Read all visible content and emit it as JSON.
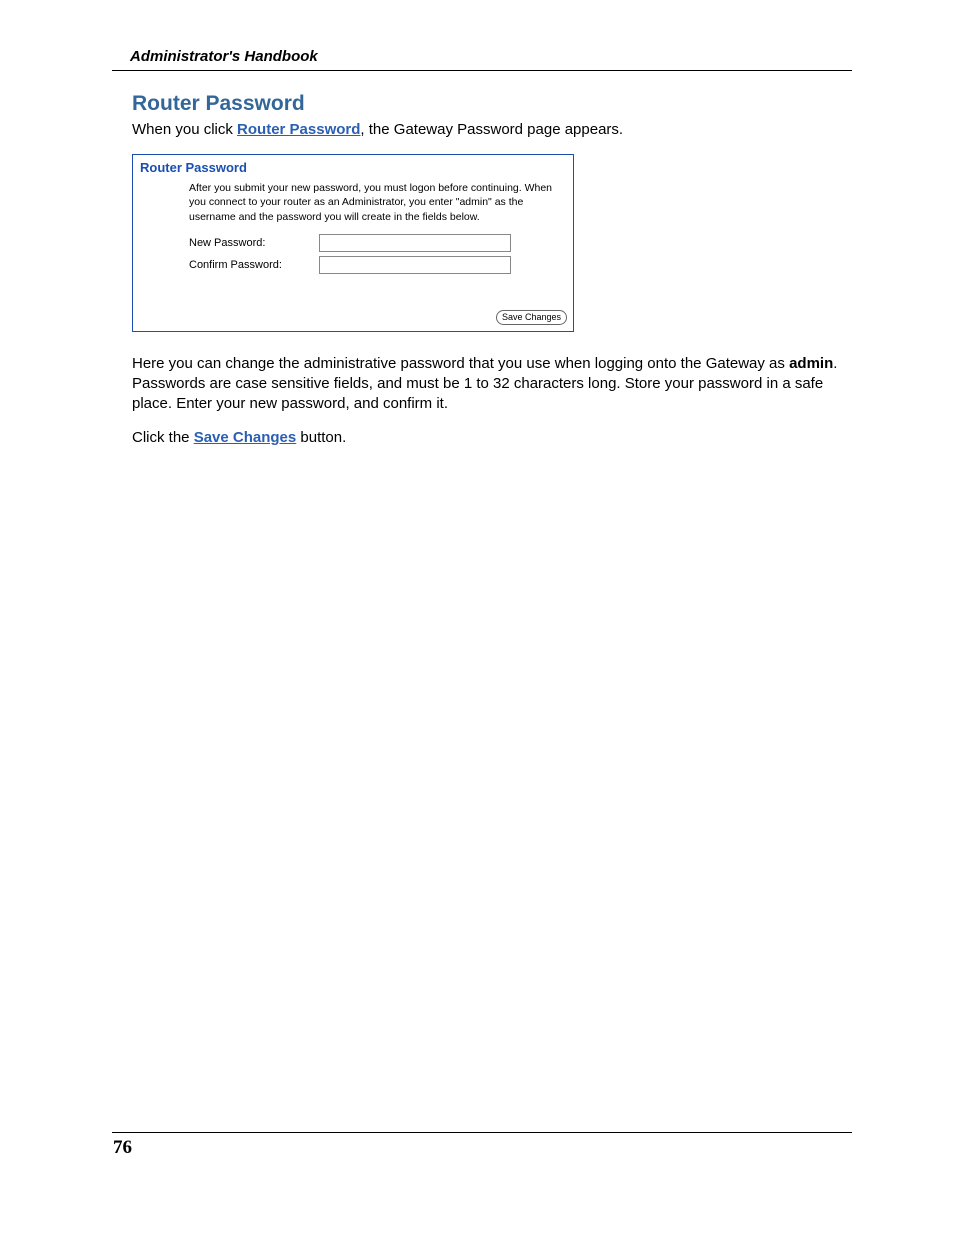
{
  "header": {
    "running_head": "Administrator's Handbook"
  },
  "title": "Router Password",
  "intro": {
    "pre": "When you click ",
    "link": "Router Password",
    "post": ", the Gateway Password page appears."
  },
  "panel": {
    "title": "Router Password",
    "instructions": "After you submit your new password, you must logon before continuing. When you connect to your router as an Administrator, you enter \"admin\" as the username and the password you will create in the fields below.",
    "new_password_label": "New Password:",
    "confirm_password_label": "Confirm Password:",
    "new_password_value": "",
    "confirm_password_value": "",
    "save_button": "Save Changes"
  },
  "para1": {
    "pre": "Here you can change the administrative password that you use when logging onto the Gateway as ",
    "bold": "admin",
    "post": ". Passwords are case sensitive fields, and must be 1 to 32 characters long. Store your password in a safe place. Enter your new password, and confirm it."
  },
  "para2": {
    "pre": "Click the ",
    "link": "Save Changes",
    "post": " button."
  },
  "page_number": "76"
}
